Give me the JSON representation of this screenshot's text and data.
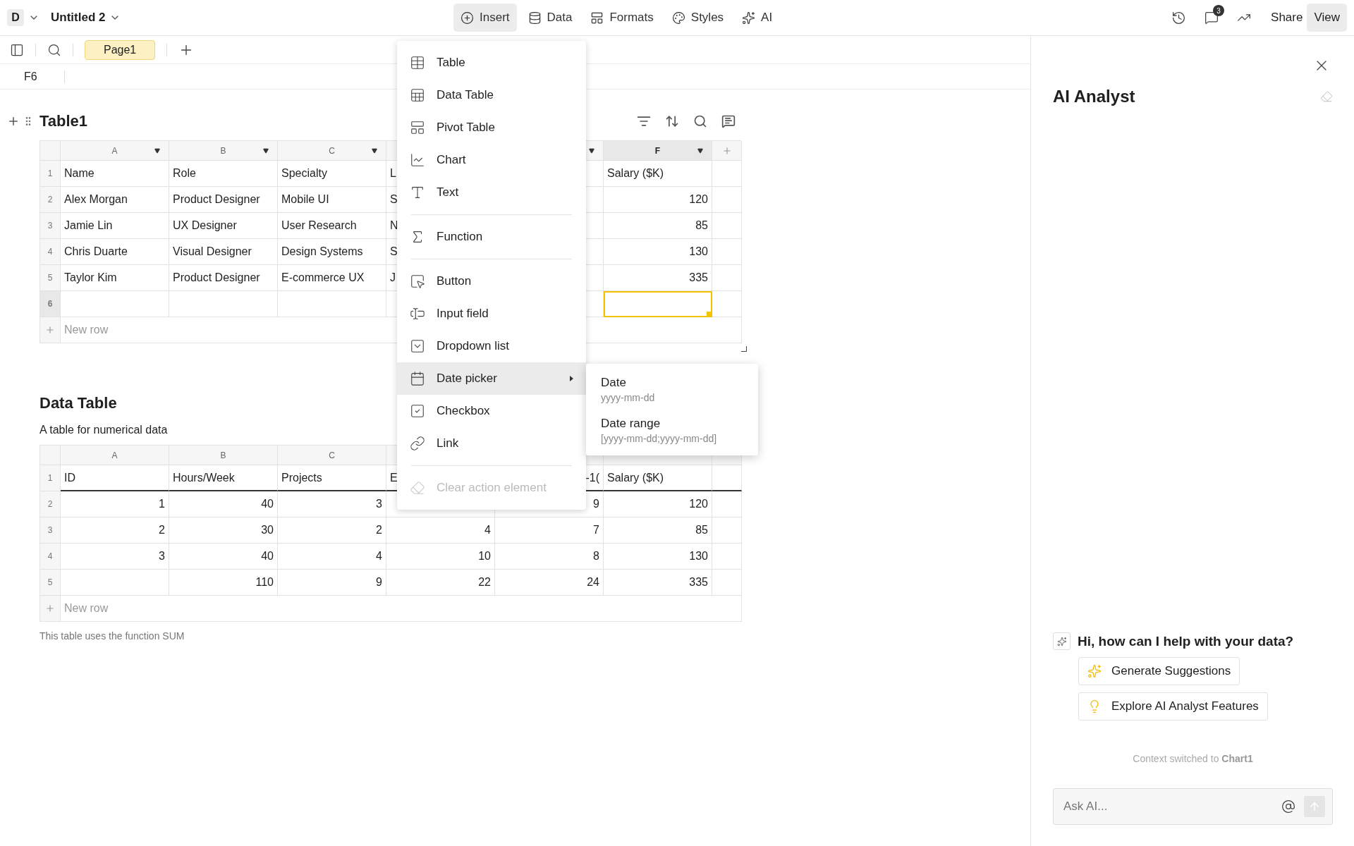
{
  "topbar": {
    "workspace": "D",
    "title": "Untitled 2",
    "menu": [
      {
        "label": "Insert",
        "selected": true
      },
      {
        "label": "Data",
        "selected": false
      },
      {
        "label": "Formats",
        "selected": false
      },
      {
        "label": "Styles",
        "selected": false
      },
      {
        "label": "AI",
        "selected": false
      }
    ],
    "notifications": "3",
    "share": "Share",
    "view": "View"
  },
  "sheet_toolbar": {
    "pages": [
      {
        "label": "Page1",
        "selected": true
      }
    ]
  },
  "formula_bar": {
    "cell_ref": "F6"
  },
  "tables": [
    {
      "kind": "table",
      "title": "Table1",
      "columns": [
        {
          "letter": "A",
          "kind": "text",
          "dropdown": true,
          "selected": false
        },
        {
          "letter": "B",
          "kind": "text",
          "dropdown": true,
          "selected": false
        },
        {
          "letter": "C",
          "kind": "text",
          "dropdown": true,
          "selected": false
        },
        {
          "kind": "text",
          "dropdown": false,
          "selected": false
        },
        {
          "kind": "text",
          "dropdown": true,
          "selected": false
        },
        {
          "letter": "F",
          "kind": "number",
          "dropdown": true,
          "selected": true
        }
      ],
      "rows": [
        {
          "number": "1",
          "kind": "header",
          "selected": false,
          "cells": [
            "Name",
            "Role",
            "Specialty",
            {
              "text": "L",
              "kind": "head"
            },
            null,
            "Salary ($K)"
          ]
        },
        {
          "number": "2",
          "kind": "data",
          "selected": false,
          "cells": [
            "Alex Morgan",
            "Product Designer",
            "Mobile UI",
            {
              "text": "S",
              "kind": "head"
            },
            null,
            "120"
          ]
        },
        {
          "number": "3",
          "kind": "data",
          "selected": false,
          "cells": [
            "Jamie Lin",
            "UX Designer",
            "User Research",
            {
              "text": "N",
              "kind": "head"
            },
            null,
            "85"
          ]
        },
        {
          "number": "4",
          "kind": "data",
          "selected": false,
          "cells": [
            "Chris Duarte",
            "Visual Designer",
            "Design Systems",
            {
              "text": "S",
              "kind": "head"
            },
            null,
            "130"
          ]
        },
        {
          "number": "5",
          "kind": "data",
          "selected": false,
          "cells": [
            "Taylor Kim",
            "Product Designer",
            "E-commerce UX",
            {
              "text": "J",
              "kind": "head"
            },
            null,
            "335"
          ]
        },
        {
          "number": "6",
          "kind": "data",
          "selected": true,
          "cells": [
            null,
            null,
            null,
            null,
            null,
            null
          ]
        }
      ],
      "new_row": "New row"
    },
    {
      "kind": "data_table",
      "title": "Data Table",
      "description": "A table for numerical data",
      "columns": [
        {
          "letter": "A",
          "kind": "number",
          "selected": false
        },
        {
          "letter": "B",
          "kind": "number",
          "selected": false
        },
        {
          "letter": "C",
          "kind": "number",
          "selected": false
        },
        {
          "kind": "number",
          "selected": false
        },
        {
          "kind": "number",
          "selected": false
        },
        {
          "kind": "number",
          "selected": false
        }
      ],
      "rows": [
        {
          "number": "1",
          "kind": "header",
          "selected": false,
          "cells": [
            "ID",
            "Hours/Week",
            "Projects",
            {
              "text": "E",
              "kind": "head"
            },
            {
              "text": "-1(",
              "kind": "tail"
            },
            "Salary ($K)"
          ]
        },
        {
          "number": "2",
          "kind": "data",
          "selected": false,
          "cells": [
            "1",
            "40",
            "3",
            null,
            "9",
            "120"
          ]
        },
        {
          "number": "3",
          "kind": "data",
          "selected": false,
          "cells": [
            "2",
            "30",
            "2",
            "4",
            "7",
            "85"
          ]
        },
        {
          "number": "4",
          "kind": "data",
          "selected": false,
          "cells": [
            "3",
            "40",
            "4",
            "10",
            "8",
            "130"
          ]
        },
        {
          "number": "5",
          "kind": "data",
          "selected": false,
          "cells": [
            null,
            "110",
            "9",
            "22",
            "24",
            "335"
          ]
        }
      ],
      "new_row": "New row",
      "footnote": "This table uses the function SUM"
    }
  ],
  "insert_menu": {
    "items": [
      {
        "kind": "item",
        "label": "Table",
        "selected": false,
        "disabled": false
      },
      {
        "kind": "item",
        "label": "Data Table",
        "selected": false,
        "disabled": false
      },
      {
        "kind": "item",
        "label": "Pivot Table",
        "selected": false,
        "disabled": false
      },
      {
        "kind": "item",
        "label": "Chart",
        "selected": false,
        "disabled": false
      },
      {
        "kind": "item",
        "label": "Text",
        "selected": false,
        "disabled": false
      },
      {
        "kind": "divider"
      },
      {
        "kind": "item",
        "label": "Function",
        "selected": false,
        "disabled": false
      },
      {
        "kind": "divider"
      },
      {
        "kind": "item",
        "label": "Button",
        "selected": false,
        "disabled": false
      },
      {
        "kind": "item",
        "label": "Input field",
        "selected": false,
        "disabled": false
      },
      {
        "kind": "item",
        "label": "Dropdown list",
        "selected": false,
        "disabled": false
      },
      {
        "kind": "submenu",
        "label": "Date picker",
        "selected": true,
        "disabled": false
      },
      {
        "kind": "item",
        "label": "Checkbox",
        "selected": false,
        "disabled": false
      },
      {
        "kind": "item",
        "label": "Link",
        "selected": false,
        "disabled": false
      },
      {
        "kind": "divider"
      },
      {
        "kind": "item",
        "label": "Clear action element",
        "selected": false,
        "disabled": true
      }
    ],
    "submenu": [
      {
        "label": "Date",
        "format": "yyyy-mm-dd"
      },
      {
        "label": "Date range",
        "format": "[yyyy-mm-dd;yyyy-mm-dd]"
      }
    ]
  },
  "ai_panel": {
    "title": "AI Analyst",
    "greeting": "Hi, how can I help with your data?",
    "actions": [
      {
        "kind": "suggest",
        "label": "Generate Suggestions"
      },
      {
        "kind": "explore",
        "label": "Explore AI Analyst Features"
      }
    ],
    "context_note": "Context switched to **Chart1**",
    "input": {
      "placeholder": "Ask AI..."
    }
  }
}
